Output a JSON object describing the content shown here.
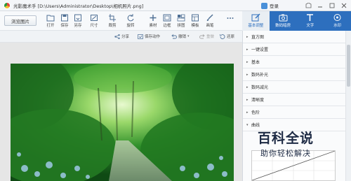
{
  "titlebar": {
    "title": "光影魔术手 [D:\\Users\\Administrator\\Desktop\\相机照片.png]",
    "login": "登录"
  },
  "toolbar": {
    "browse": "浏览图片",
    "tools": [
      "打开",
      "保存",
      "另存",
      "尺寸",
      "裁剪",
      "旋转",
      "素材",
      "边框",
      "拼图",
      "模板",
      "画笔"
    ]
  },
  "right_tabs": [
    "基本调整",
    "数码暗房",
    "文字",
    "水印"
  ],
  "actionbar": {
    "share": "分享",
    "save_action": "保存动作",
    "undo": "撤销",
    "redo": "重做",
    "restore": "还原"
  },
  "panel_items": [
    "直方图",
    "一键设置",
    "基本",
    "数码补光",
    "数码减光",
    "清晰度",
    "色阶",
    "曲线"
  ],
  "watermark": {
    "main": "百科全说",
    "sub": "助你轻松解决"
  },
  "colors": {
    "accent": "#2d6fbe",
    "forest": "#2a8a2f"
  }
}
